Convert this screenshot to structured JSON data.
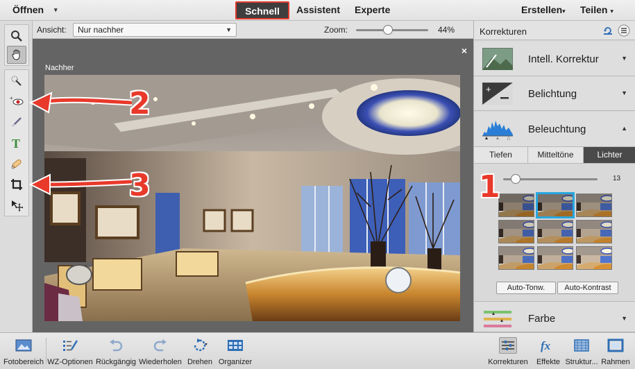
{
  "topbar": {
    "open_label": "Öffnen",
    "open_caret": "▾",
    "modes": {
      "quick": "Schnell",
      "guided": "Assistent",
      "expert": "Experte"
    },
    "create_label": "Erstellen",
    "share_label": "Teilen",
    "caret": "▾"
  },
  "options": {
    "view_label": "Ansicht:",
    "view_value": "Nur nachher",
    "zoom_label": "Zoom:",
    "zoom_value": "44%",
    "zoom_percent": 44
  },
  "canvas": {
    "close_label": "×",
    "after_label": "Nachher"
  },
  "annotations": {
    "n1": "1",
    "n2": "2",
    "n3": "3",
    "color": "#e8392b"
  },
  "tools": [
    {
      "name": "zoom-tool",
      "icon": "magnifier-icon"
    },
    {
      "name": "hand-tool",
      "icon": "hand-icon",
      "active": true
    },
    {
      "name": "quick-selection-tool",
      "icon": "quick-selection-icon"
    },
    {
      "name": "red-eye-tool",
      "icon": "eye-icon"
    },
    {
      "name": "whiten-teeth-tool",
      "icon": "brush-icon"
    },
    {
      "name": "type-tool",
      "icon": "type-icon"
    },
    {
      "name": "spot-healing-tool",
      "icon": "bandage-icon"
    },
    {
      "name": "crop-tool",
      "icon": "crop-icon"
    },
    {
      "name": "move-tool",
      "icon": "move-icon"
    }
  ],
  "panel": {
    "title": "Korrekturen",
    "adjustments": {
      "smart_fix": "Intell. Korrektur",
      "exposure": "Belichtung",
      "lighting": "Beleuchtung",
      "color": "Farbe"
    },
    "lighting_tabs": {
      "shadows": "Tiefen",
      "midtones": "Mitteltöne",
      "highlights": "Lichter"
    },
    "active_tab": "highlights",
    "slider_value": "13",
    "slider_fraction": 0.13,
    "buttons": {
      "auto_tone": "Auto-Tonw.",
      "auto_contrast": "Auto-Kontrast"
    },
    "selected_thumb": 2,
    "accent": "#27a7e0"
  },
  "bottombar": {
    "photo_bin": "Fotobereich",
    "tool_options": "WZ-Optionen",
    "undo": "Rückgängig",
    "redo": "Wiederholen",
    "rotate": "Drehen",
    "organizer": "Organizer",
    "adjustments": "Korrekturen",
    "effects": "Effekte",
    "textures": "Struktur...",
    "frames": "Rahmen"
  }
}
